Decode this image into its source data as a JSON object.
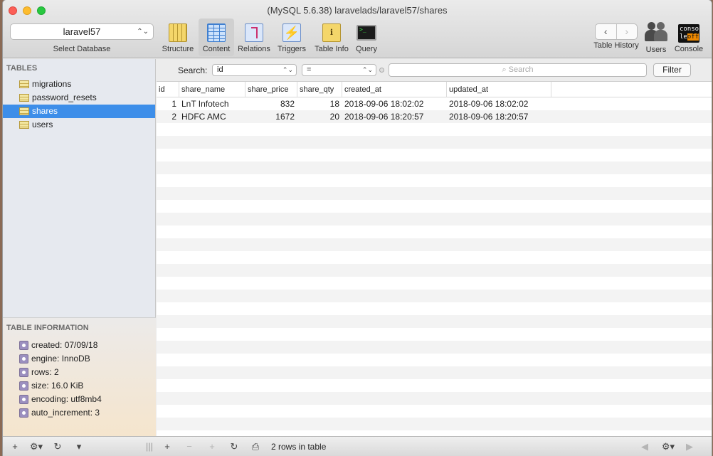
{
  "window": {
    "title": "(MySQL 5.6.38) laravelads/laravel57/shares"
  },
  "database": {
    "selected": "laravel57",
    "label": "Select Database"
  },
  "toolbar": {
    "structure": "Structure",
    "content": "Content",
    "relations": "Relations",
    "triggers": "Triggers",
    "table_info": "Table Info",
    "query": "Query",
    "table_history": "Table History",
    "users": "Users",
    "console": "Console",
    "console_icon_text1": "conso",
    "console_icon_text2": "le",
    "console_icon_text3": "off"
  },
  "sidebar": {
    "heading": "TABLES",
    "tables": [
      "migrations",
      "password_resets",
      "shares",
      "users"
    ],
    "selected": "shares"
  },
  "table_info": {
    "heading": "TABLE INFORMATION",
    "items": [
      "created: 07/09/18",
      "engine: InnoDB",
      "rows: 2",
      "size: 16.0 KiB",
      "encoding: utf8mb4",
      "auto_increment: 3"
    ]
  },
  "filter": {
    "label": "Search:",
    "field": "id",
    "operator": "=",
    "placeholder": "Search",
    "button": "Filter"
  },
  "grid": {
    "columns": [
      "id",
      "share_name",
      "share_price",
      "share_qty",
      "created_at",
      "updated_at"
    ],
    "rows": [
      [
        "1",
        "LnT Infotech",
        "832",
        "18",
        "2018-09-06 18:02:02",
        "2018-09-06 18:02:02"
      ],
      [
        "2",
        "HDFC AMC",
        "1672",
        "20",
        "2018-09-06 18:20:57",
        "2018-09-06 18:20:57"
      ]
    ]
  },
  "status": {
    "rows_text": "2 rows in table"
  },
  "colors": {
    "selection": "#3d8ee9",
    "close": "#fc5f57",
    "minimize": "#fdbc2e",
    "zoom": "#28c840"
  }
}
